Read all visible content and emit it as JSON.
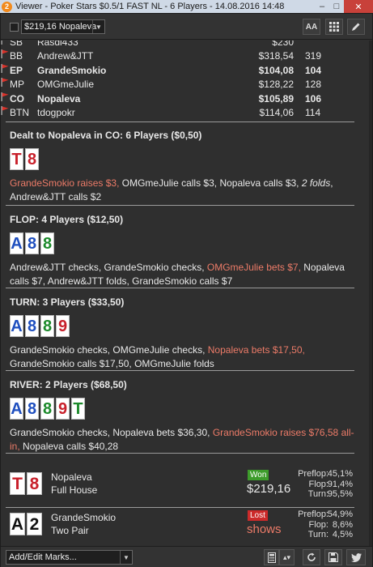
{
  "window": {
    "title": "Viewer - Poker Stars $0.5/1 FAST NL - 6 Players - 14.08.2016 14:48",
    "logo": "2",
    "minimize": "–",
    "maximize": "□",
    "close": "✕"
  },
  "toolbar": {
    "player_select": "$219,16 Nopaleva",
    "font_button": "AA",
    "grid_icon": "grid-icon",
    "edit_icon": "pencil-icon"
  },
  "players": [
    {
      "pos": "SB",
      "name": "Rasdi433",
      "stack": "$230",
      "bb": "",
      "bold": false
    },
    {
      "pos": "BB",
      "name": "Andrew&JTT",
      "stack": "$318,54",
      "bb": "319",
      "bold": false
    },
    {
      "pos": "EP",
      "name": "GrandeSmokio",
      "stack": "$104,08",
      "bb": "104",
      "bold": true
    },
    {
      "pos": "MP",
      "name": "OMGmeJulie",
      "stack": "$128,22",
      "bb": "128",
      "bold": false
    },
    {
      "pos": "CO",
      "name": "Nopaleva",
      "stack": "$105,89",
      "bb": "106",
      "bold": true
    },
    {
      "pos": "BTN",
      "name": "tdogpokr",
      "stack": "$114,06",
      "bb": "114",
      "bold": false
    }
  ],
  "preflop": {
    "header": "Dealt to Nopaleva in CO: 6 Players ($0,50)",
    "cards": [
      {
        "r": "T",
        "s": "h"
      },
      {
        "r": "8",
        "s": "h"
      }
    ],
    "a1": "GrandeSmokio raises $3,",
    "a2": " OMGmeJulie calls $3, Nopaleva calls $3, ",
    "a3": "2 folds",
    "a4": ", Andrew&JTT calls $2"
  },
  "flop": {
    "header": "FLOP: 4 Players ($12,50)",
    "cards": [
      {
        "r": "A",
        "s": "d"
      },
      {
        "r": "8",
        "s": "d"
      },
      {
        "r": "8",
        "s": "c"
      }
    ],
    "a1": "Andrew&JTT checks, GrandeSmokio checks, ",
    "a2": "OMGmeJulie bets $7,",
    "a3": " Nopaleva calls $7, Andrew&JTT folds, GrandeSmokio calls $7"
  },
  "turn": {
    "header": "TURN: 3 Players ($33,50)",
    "cards": [
      {
        "r": "A",
        "s": "d"
      },
      {
        "r": "8",
        "s": "d"
      },
      {
        "r": "8",
        "s": "c"
      },
      {
        "r": "9",
        "s": "h"
      }
    ],
    "a1": "GrandeSmokio checks, OMGmeJulie checks, ",
    "a2": "Nopaleva bets $17,50,",
    "a3": " GrandeSmokio calls $17,50, OMGmeJulie folds"
  },
  "river": {
    "header": "RIVER: 2 Players ($68,50)",
    "cards": [
      {
        "r": "A",
        "s": "d"
      },
      {
        "r": "8",
        "s": "d"
      },
      {
        "r": "8",
        "s": "c"
      },
      {
        "r": "9",
        "s": "h"
      },
      {
        "r": "T",
        "s": "c"
      }
    ],
    "a1": "GrandeSmokio checks, Nopaleva bets $36,30, ",
    "a2": "GrandeSmokio raises $76,58 all-in,",
    "a3": " Nopaleva calls $40,28"
  },
  "results": [
    {
      "cards": [
        {
          "r": "T",
          "s": "h"
        },
        {
          "r": "8",
          "s": "h"
        }
      ],
      "name": "Nopaleva",
      "hand": "Full House",
      "badge": "Won",
      "value": "$219,16",
      "eq": [
        {
          "k": "Preflop:",
          "v": "45,1%"
        },
        {
          "k": "Flop:",
          "v": "91,4%"
        },
        {
          "k": "Turn:",
          "v": "95,5%"
        }
      ]
    },
    {
      "cards": [
        {
          "r": "A",
          "s": "s"
        },
        {
          "r": "2",
          "s": "s"
        }
      ],
      "name": "GrandeSmokio",
      "hand": "Two Pair",
      "badge": "Lost",
      "value": "shows",
      "eq": [
        {
          "k": "Preflop:",
          "v": "54,9%"
        },
        {
          "k": "Flop:",
          "v": "8,6%"
        },
        {
          "k": "Turn:",
          "v": "4,5%"
        }
      ]
    }
  ],
  "bottom": {
    "marks_label": "Add/Edit Marks...",
    "calc_icon": "calculator-icon",
    "stepper_icon": "stepper-icon",
    "refresh_icon": "refresh-icon",
    "save_icon": "save-icon",
    "twitter_icon": "twitter-icon"
  },
  "colors": {
    "hearts": "#c8202b",
    "spades": "#111111",
    "diamonds": "#1f4fbf",
    "clubs": "#1d8a2c",
    "highlight": "#ec7b68",
    "won": "#3d9c2b",
    "lost": "#cc2a2a",
    "flag": "#d9322a"
  }
}
